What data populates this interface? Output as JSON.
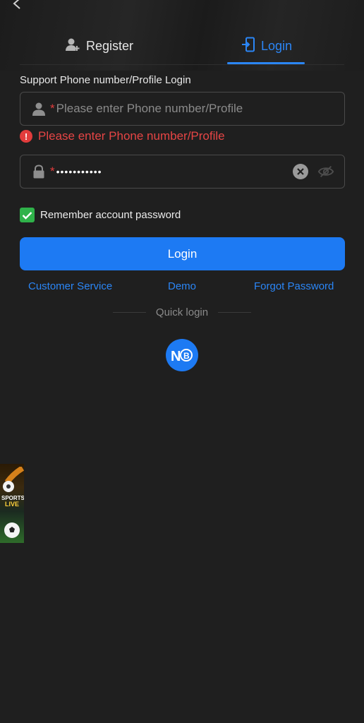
{
  "tabs": {
    "register": "Register",
    "login": "Login"
  },
  "form": {
    "section_label": "Support Phone number/Profile Login",
    "phone_placeholder": "Please enter Phone number/Profile",
    "error_message": "Please enter Phone number/Profile",
    "password_masked": "•••••••••••",
    "required_mark": "*",
    "remember_label": "Remember account password",
    "login_button": "Login"
  },
  "links": {
    "customer_service": "Customer Service",
    "demo": "Demo",
    "forgot_password": "Forgot Password"
  },
  "quick_login": {
    "label": "Quick login"
  },
  "banner": {
    "line1": "SPORTS",
    "line2": "LIVE"
  },
  "colors": {
    "accent": "#1d7af3",
    "error": "#e64545",
    "check": "#2fb24a",
    "background": "#1f1f1f"
  },
  "icons": [
    "back-icon",
    "user-add-icon",
    "login-icon",
    "user-icon",
    "lock-icon",
    "clear-icon",
    "eye-off-icon",
    "error-icon",
    "check-icon",
    "quick-login-icon"
  ]
}
